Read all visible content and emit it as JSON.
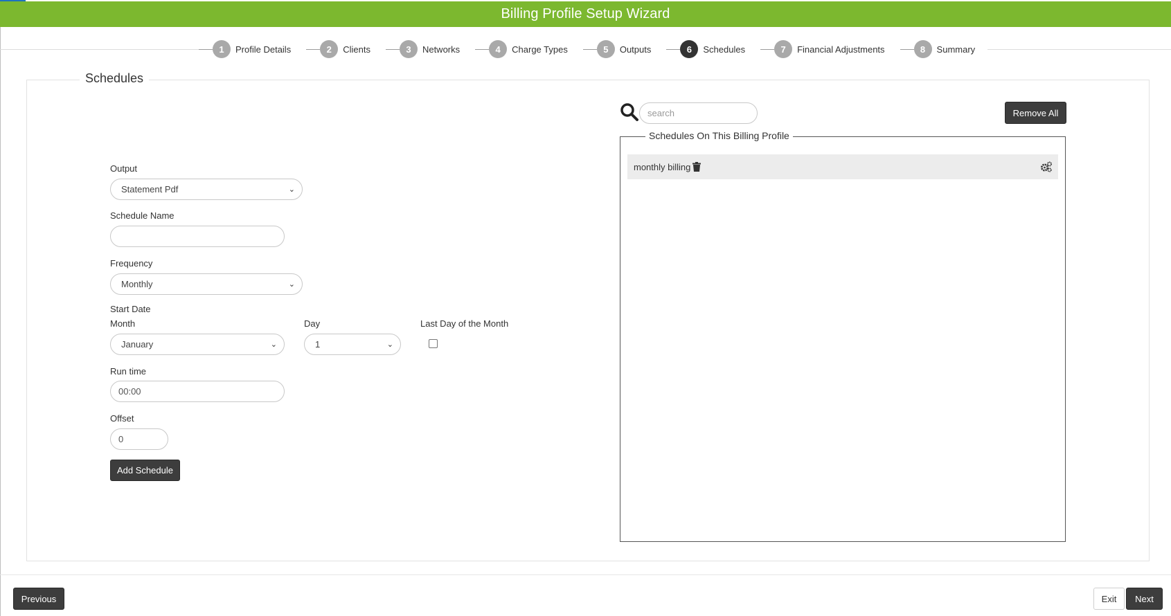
{
  "header": {
    "title": "Billing Profile Setup Wizard"
  },
  "steps": [
    {
      "num": "1",
      "label": "Profile Details"
    },
    {
      "num": "2",
      "label": "Clients"
    },
    {
      "num": "3",
      "label": "Networks"
    },
    {
      "num": "4",
      "label": "Charge Types"
    },
    {
      "num": "5",
      "label": "Outputs"
    },
    {
      "num": "6",
      "label": "Schedules",
      "active": true
    },
    {
      "num": "7",
      "label": "Financial Adjustments"
    },
    {
      "num": "8",
      "label": "Summary"
    }
  ],
  "panel": {
    "title": "Schedules"
  },
  "form": {
    "output_label": "Output",
    "output_value": "Statement Pdf",
    "schedule_name_label": "Schedule Name",
    "schedule_name_value": "",
    "frequency_label": "Frequency",
    "frequency_value": "Monthly",
    "start_date_label": "Start Date",
    "month_label": "Month",
    "month_value": "January",
    "day_label": "Day",
    "day_value": "1",
    "last_day_label": "Last Day of the Month",
    "last_day_checked": false,
    "run_time_label": "Run time",
    "run_time_value": "00:00",
    "offset_label": "Offset",
    "offset_value": "0",
    "add_button": "Add Schedule"
  },
  "schedules": {
    "search_placeholder": "search",
    "remove_all_button": "Remove All",
    "list_title": "Schedules On This Billing Profile",
    "items": [
      {
        "name": "monthly billing"
      }
    ]
  },
  "footer": {
    "previous_button": "Previous",
    "exit_button": "Exit",
    "next_button": "Next"
  },
  "colors": {
    "header_bg": "#7cb82f",
    "dark_button": "#3d3d3d",
    "step_active": "#333333",
    "step_inactive": "#a9a9a9"
  }
}
